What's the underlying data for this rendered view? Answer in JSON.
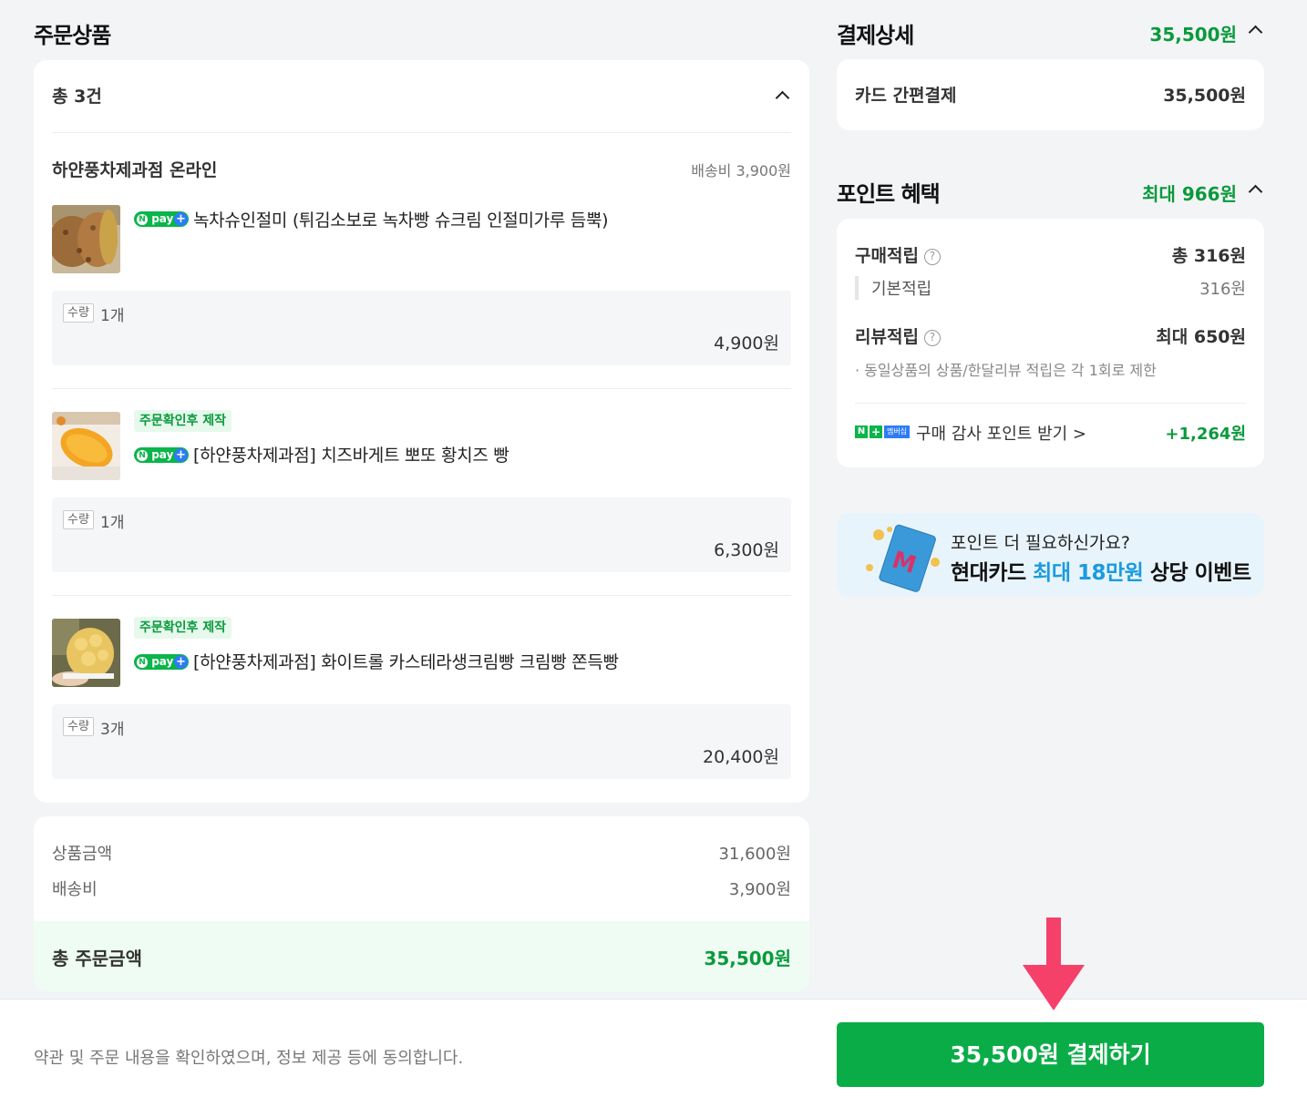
{
  "order": {
    "title": "주문상품",
    "total_count": "총 3건",
    "seller": "하얀풍차제과점 온라인",
    "shipping": "배송비 3,900원",
    "items": [
      {
        "badge": "",
        "npay": "pay",
        "name": "녹차슈인절미 (튀김소보로 녹차빵 슈크림 인절미가루 듬뿍)",
        "qty_label": "수량",
        "qty": "1개",
        "price": "4,900원"
      },
      {
        "badge": "주문확인후 제작",
        "npay": "pay",
        "name": "[하얀풍차제과점] 치즈바게트 뽀또 황치즈 빵",
        "qty_label": "수량",
        "qty": "1개",
        "price": "6,300원"
      },
      {
        "badge": "주문확인후 제작",
        "npay": "pay",
        "name": "[하얀풍차제과점] 화이트롤 카스테라생크림빵 크림빵 쫀득빵",
        "qty_label": "수량",
        "qty": "3개",
        "price": "20,400원"
      }
    ]
  },
  "summary": {
    "product_label": "상품금액",
    "product_value": "31,600원",
    "shipping_label": "배송비",
    "shipping_value": "3,900원",
    "total_label": "총 주문금액",
    "total_value": "35,500원"
  },
  "payment": {
    "title": "결제상세",
    "amount": "35,500원",
    "method_label": "카드 간편결제",
    "method_value": "35,500원"
  },
  "points": {
    "title": "포인트 혜택",
    "max": "최대 966원",
    "purchase_label": "구매적립",
    "purchase_value": "총 316원",
    "basic_label": "기본적립",
    "basic_value": "316원",
    "review_label": "리뷰적립",
    "review_value": "최대 650원",
    "review_note": "· 동일상품의 상품/한달리뷰 적립은 각 1회로 제한",
    "member_badge": "멤버십",
    "member_link": "구매 감사 포인트 받기 >",
    "member_value": "+1,264원"
  },
  "banner": {
    "line1": "포인트 더 필요하신가요?",
    "line2_a": "현대카드 ",
    "line2_hl": "최대 18만원",
    "line2_b": " 상당 이벤트"
  },
  "footer": {
    "agree_text": "약관 및 주문 내용을 확인하였으며, 정보 제공 등에 동의합니다.",
    "pay_button": "35,500원 결제하기"
  },
  "colors": {
    "accent_green": "#0aac47",
    "text_green": "#0a9a3c",
    "arrow_pink": "#f5406a",
    "highlight_blue": "#1a9be0"
  }
}
